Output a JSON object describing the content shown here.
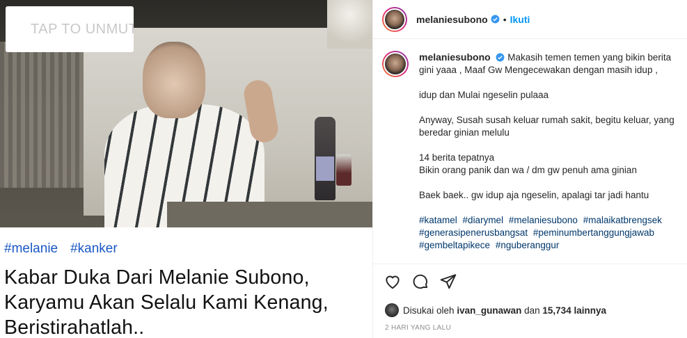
{
  "media": {
    "mute_label": "TAP TO UNMUTE",
    "tags": [
      "#melanie",
      "#kanker"
    ],
    "headline_lines": [
      "Kabar Duka Dari Melanie Subono,",
      "Karyamu Akan Selalu Kami Kenang,",
      "Beristirahatlah.."
    ]
  },
  "header": {
    "username": "melaniesubono",
    "separator": "•",
    "follow_label": "Ikuti"
  },
  "post": {
    "username": "melaniesubono",
    "paragraphs": [
      "Makasih temen temen yang bikin berita gini yaaa , Maaf Gw Mengecewakan dengan masih idup ,",
      "idup dan Mulai ngeselin pulaaa",
      "Anyway, Susah susah keluar rumah sakit, begitu keluar, yang beredar ginian melulu",
      "14 berita tepatnya\nBikin orang panik dan wa / dm gw penuh ama ginian",
      "Baek baek.. gw idup aja ngeselin, apalagi tar jadi hantu"
    ],
    "hashtags": [
      "#katamel",
      "#diarymel",
      "#melaniesubono",
      "#malaikatbrengsek",
      "#generasipenerusbangsat",
      "#peminumbertanggungjawab",
      "#gembeltapikece",
      "#nguberanggur"
    ]
  },
  "likes": {
    "prefix": "Disukai oleh",
    "liker": "ivan_gunawan",
    "middle": "dan",
    "count": "15,734 lainnya"
  },
  "timestamp": "2 HARI YANG LALU",
  "icons": [
    "mute-icon",
    "verified-icon",
    "heart-icon",
    "comment-icon",
    "share-icon"
  ],
  "colors": {
    "link": "#0095f6",
    "hashtag": "#00376b",
    "media_tag": "#1a57c4"
  }
}
